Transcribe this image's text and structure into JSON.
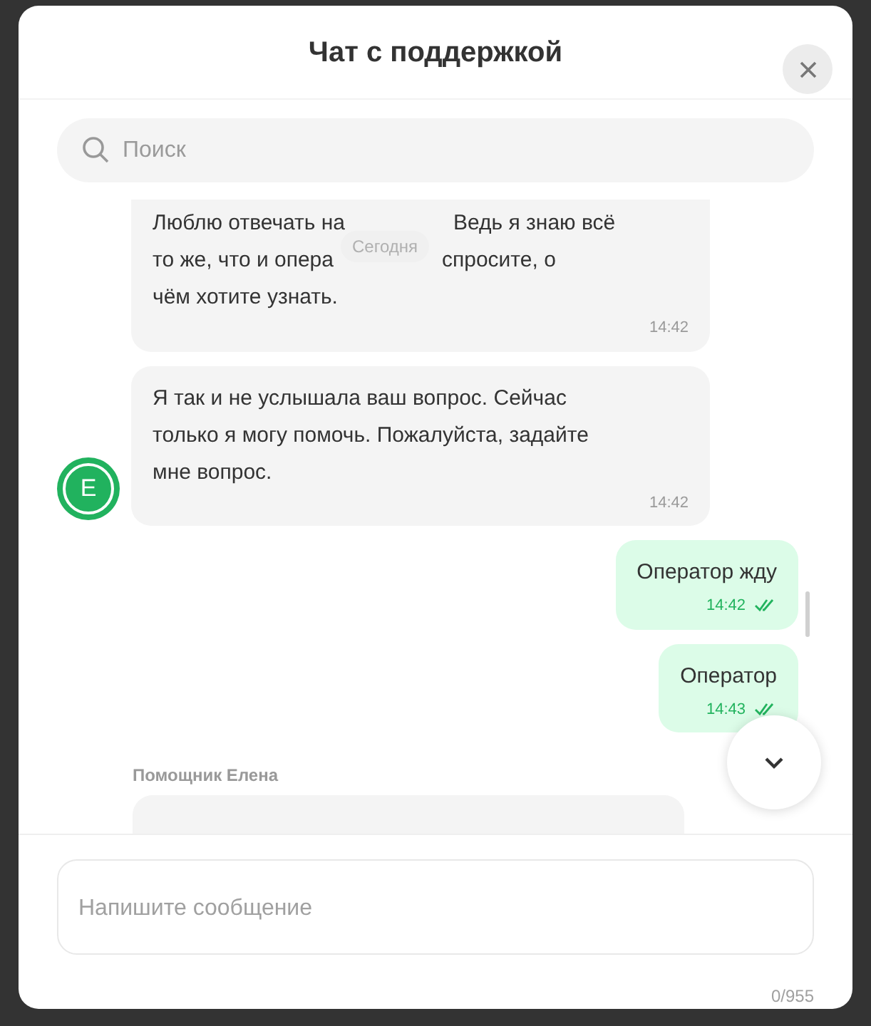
{
  "header": {
    "title": "Чат с поддержкой"
  },
  "search": {
    "placeholder": "Поиск"
  },
  "date_divider": "Сегодня",
  "messages": [
    {
      "kind": "incoming",
      "lines": [
        [
          "Люблю отвечать на",
          "Ведь я знаю всё"
        ],
        [
          "то же, что и опера",
          "спросите, о"
        ],
        [
          "чём хотите узнать."
        ]
      ],
      "time": "14:42",
      "avatar": false
    },
    {
      "kind": "incoming",
      "text": "Я так и не услышала ваш вопрос. Сейчас только я могу помочь. Пожалуйста, задайте мне вопрос.",
      "time": "14:42",
      "avatar": true,
      "avatar_letter": "Е"
    },
    {
      "kind": "outgoing",
      "text": "Оператор жду",
      "time": "14:42",
      "read": true
    },
    {
      "kind": "outgoing",
      "text": "Оператор",
      "time": "14:43",
      "read": true
    },
    {
      "kind": "sender",
      "text": "Помощник Елена"
    },
    {
      "kind": "cut"
    }
  ],
  "composer": {
    "placeholder": "Напишите сообщение",
    "counter": "0/955"
  }
}
